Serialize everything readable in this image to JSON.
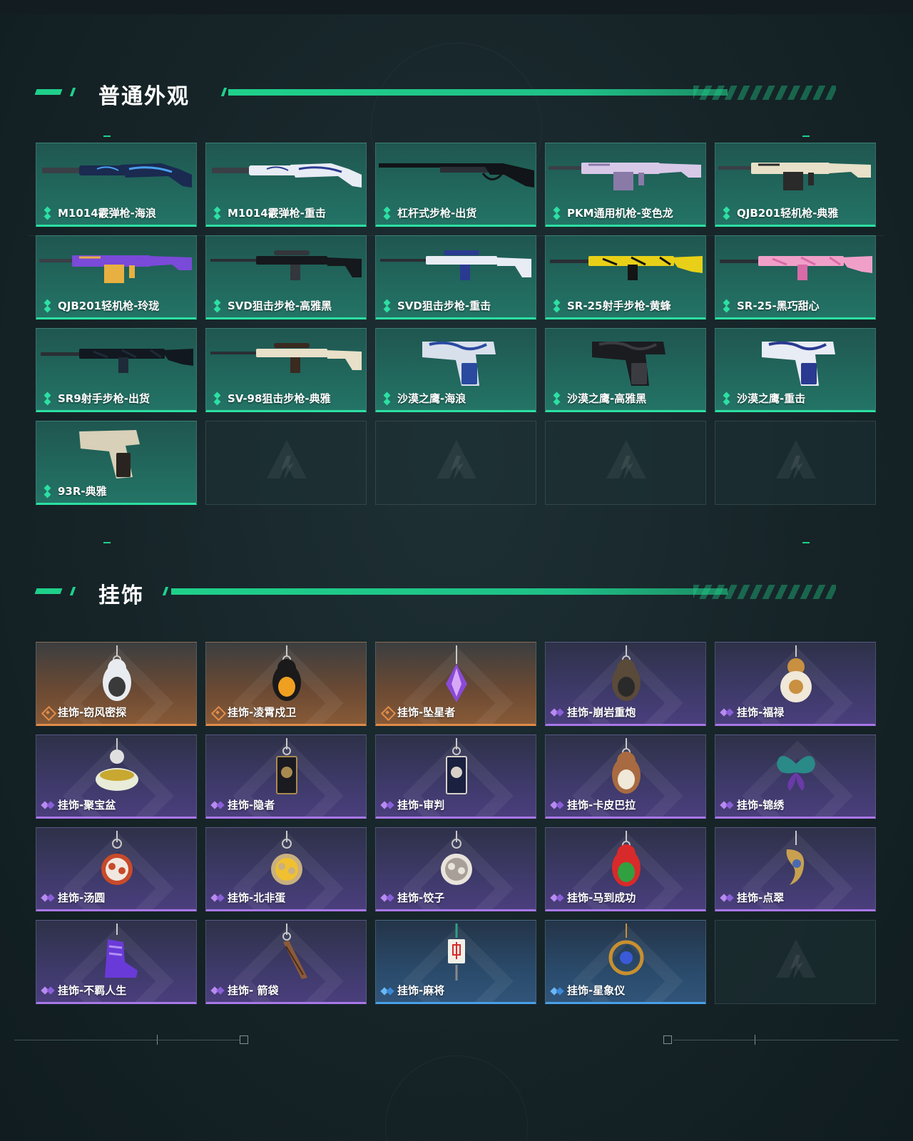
{
  "sections": {
    "skins": {
      "title": "普通外观",
      "items": [
        {
          "label": "M1014霰弹枪-海浪",
          "rarity": "green",
          "art": "shotgun",
          "colors": [
            "#1a2a50",
            "#4aa0f0"
          ]
        },
        {
          "label": "M1014霰弹枪-重击",
          "rarity": "green",
          "art": "shotgun",
          "colors": [
            "#e8ecf4",
            "#2a3a90"
          ]
        },
        {
          "label": "杠杆式步枪-出货",
          "rarity": "green",
          "art": "lever",
          "colors": [
            "#111418",
            "#2a2f36"
          ]
        },
        {
          "label": "PKM通用机枪-变色龙",
          "rarity": "green",
          "art": "lmg",
          "colors": [
            "#d8c8e8",
            "#8a7aa8"
          ]
        },
        {
          "label": "QJB201轻机枪-典雅",
          "rarity": "green",
          "art": "lmg",
          "colors": [
            "#e8e0c8",
            "#2a2a2a"
          ]
        },
        {
          "label": "QJB201轻机枪-玲珑",
          "rarity": "green",
          "art": "lmg",
          "colors": [
            "#7a4ad8",
            "#e8b040"
          ]
        },
        {
          "label": "SVD狙击步枪-高雅黑",
          "rarity": "green",
          "art": "sniper",
          "colors": [
            "#15181c",
            "#33363c"
          ]
        },
        {
          "label": "SVD狙击步枪-重击",
          "rarity": "green",
          "art": "sniper",
          "colors": [
            "#e8ecf4",
            "#2a3a90"
          ]
        },
        {
          "label": "SR-25射手步枪-黄蜂",
          "rarity": "green",
          "art": "rifle",
          "colors": [
            "#e8d018",
            "#141414"
          ]
        },
        {
          "label": "SR-25-黑巧甜心",
          "rarity": "green",
          "art": "rifle",
          "colors": [
            "#f0a0c8",
            "#d86aa8"
          ]
        },
        {
          "label": "SR9射手步枪-出货",
          "rarity": "green",
          "art": "rifle",
          "colors": [
            "#121820",
            "#1e2a38"
          ]
        },
        {
          "label": "SV-98狙击步枪-典雅",
          "rarity": "green",
          "art": "sniper",
          "colors": [
            "#e8e0c8",
            "#3a2a20"
          ]
        },
        {
          "label": "沙漠之鹰-海浪",
          "rarity": "green",
          "art": "pistol",
          "colors": [
            "#d8e0ec",
            "#2a4aa0"
          ]
        },
        {
          "label": "沙漠之鹰-高雅黑",
          "rarity": "green",
          "art": "pistol",
          "colors": [
            "#1a1c20",
            "#3a3c42"
          ]
        },
        {
          "label": "沙漠之鹰-重击",
          "rarity": "green",
          "art": "pistol",
          "colors": [
            "#e8ecf4",
            "#2a3a90"
          ]
        },
        {
          "label": "93R-典雅",
          "rarity": "green",
          "art": "pistol-small",
          "colors": [
            "#d8d0b8",
            "#2a2420"
          ]
        },
        {
          "label": "",
          "rarity": "empty"
        },
        {
          "label": "",
          "rarity": "empty"
        },
        {
          "label": "",
          "rarity": "empty"
        },
        {
          "label": "",
          "rarity": "empty"
        }
      ]
    },
    "charms": {
      "title": "挂饰",
      "items": [
        {
          "label": "挂饰-窃风密探",
          "rarity": "orange",
          "art": "rabbit",
          "colors": [
            "#e8ecf0",
            "#3a3a3a"
          ]
        },
        {
          "label": "挂饰-凌霄戍卫",
          "rarity": "orange",
          "art": "penguin",
          "colors": [
            "#1a1a1a",
            "#f0a020"
          ]
        },
        {
          "label": "挂饰-坠星者",
          "rarity": "orange",
          "art": "crystal",
          "colors": [
            "#8a4ad8",
            "#d8a8f8"
          ]
        },
        {
          "label": "挂饰-崩岩重炮",
          "rarity": "purple",
          "art": "figure",
          "colors": [
            "#5a4a3a",
            "#2a2a2a"
          ]
        },
        {
          "label": "挂饰-福禄",
          "rarity": "purple",
          "art": "gourd",
          "colors": [
            "#f0e8d8",
            "#c89040"
          ]
        },
        {
          "label": "挂饰-聚宝盆",
          "rarity": "purple",
          "art": "bowl",
          "colors": [
            "#e8ecd8",
            "#c8a830"
          ]
        },
        {
          "label": "挂饰-隐者",
          "rarity": "purple",
          "art": "card",
          "colors": [
            "#1a1a20",
            "#a88a50"
          ]
        },
        {
          "label": "挂饰-审判",
          "rarity": "purple",
          "art": "card",
          "colors": [
            "#1a2040",
            "#d8d0c8"
          ]
        },
        {
          "label": "挂饰-卡皮巴拉",
          "rarity": "purple",
          "art": "capybara",
          "colors": [
            "#a86a40",
            "#f0e8d8"
          ]
        },
        {
          "label": "挂饰-锦绣",
          "rarity": "purple",
          "art": "butterfly",
          "colors": [
            "#2a8a88",
            "#6a3aa8"
          ]
        },
        {
          "label": "挂饰-汤圆",
          "rarity": "purple",
          "art": "dish",
          "colors": [
            "#c84a2a",
            "#f0e8e0"
          ]
        },
        {
          "label": "挂饰-北非蛋",
          "rarity": "purple",
          "art": "dish",
          "colors": [
            "#c8b080",
            "#f0c030"
          ]
        },
        {
          "label": "挂饰-饺子",
          "rarity": "purple",
          "art": "dish",
          "colors": [
            "#e8e4dc",
            "#a8a098"
          ]
        },
        {
          "label": "挂饰-马到成功",
          "rarity": "purple",
          "art": "horse",
          "colors": [
            "#d82a2a",
            "#30a040"
          ]
        },
        {
          "label": "挂饰-点翠",
          "rarity": "purple",
          "art": "jewel",
          "colors": [
            "#c8a050",
            "#4a6ab0"
          ]
        },
        {
          "label": "挂饰-不羁人生",
          "rarity": "purple",
          "art": "shoe",
          "colors": [
            "#6a3ad8",
            "#b090f0"
          ]
        },
        {
          "label": "挂饰- 箭袋",
          "rarity": "purple",
          "art": "quiver",
          "colors": [
            "#8a5a3a",
            "#4a2a1a"
          ]
        },
        {
          "label": "挂饰-麻将",
          "rarity": "blue",
          "art": "mahjong",
          "colors": [
            "#f0f0e8",
            "#d82a2a"
          ]
        },
        {
          "label": "挂饰-星象仪",
          "rarity": "blue",
          "art": "astrolabe",
          "colors": [
            "#c89030",
            "#3a5ad8"
          ]
        },
        {
          "label": "",
          "rarity": "empty"
        }
      ]
    }
  },
  "theme": {
    "accent": "#1fd08a",
    "green": "#2ce0a2",
    "orange": "#e08c4a",
    "purple": "#a877e8",
    "blue": "#4aa0e8"
  }
}
